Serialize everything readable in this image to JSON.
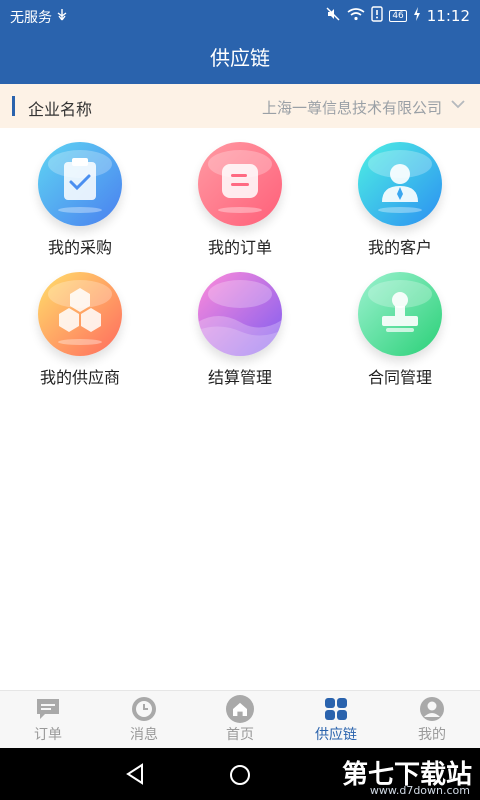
{
  "status": {
    "carrier": "无服务",
    "time": "11:12",
    "battery": "46"
  },
  "header": {
    "title": "供应链"
  },
  "company": {
    "label": "企业名称",
    "value": "上海一尊信息技术有限公司"
  },
  "tiles": [
    {
      "label": "我的采购",
      "icon": "clipboard-check-icon"
    },
    {
      "label": "我的订单",
      "icon": "order-note-icon"
    },
    {
      "label": "我的客户",
      "icon": "person-icon"
    },
    {
      "label": "我的供应商",
      "icon": "hexagons-icon"
    },
    {
      "label": "结算管理",
      "icon": "wave-icon"
    },
    {
      "label": "合同管理",
      "icon": "stamp-icon"
    }
  ],
  "nav": [
    {
      "label": "订单",
      "icon": "chat-icon"
    },
    {
      "label": "消息",
      "icon": "clock-icon"
    },
    {
      "label": "首页",
      "icon": "home-icon"
    },
    {
      "label": "供应链",
      "icon": "grid-icon",
      "active": true
    },
    {
      "label": "我的",
      "icon": "user-icon"
    }
  ],
  "watermark": {
    "brand": "第七下载站",
    "url": "www.d7down.com"
  },
  "colors": {
    "primary": "#2a63ad",
    "company_bg": "#fdf2e6"
  }
}
